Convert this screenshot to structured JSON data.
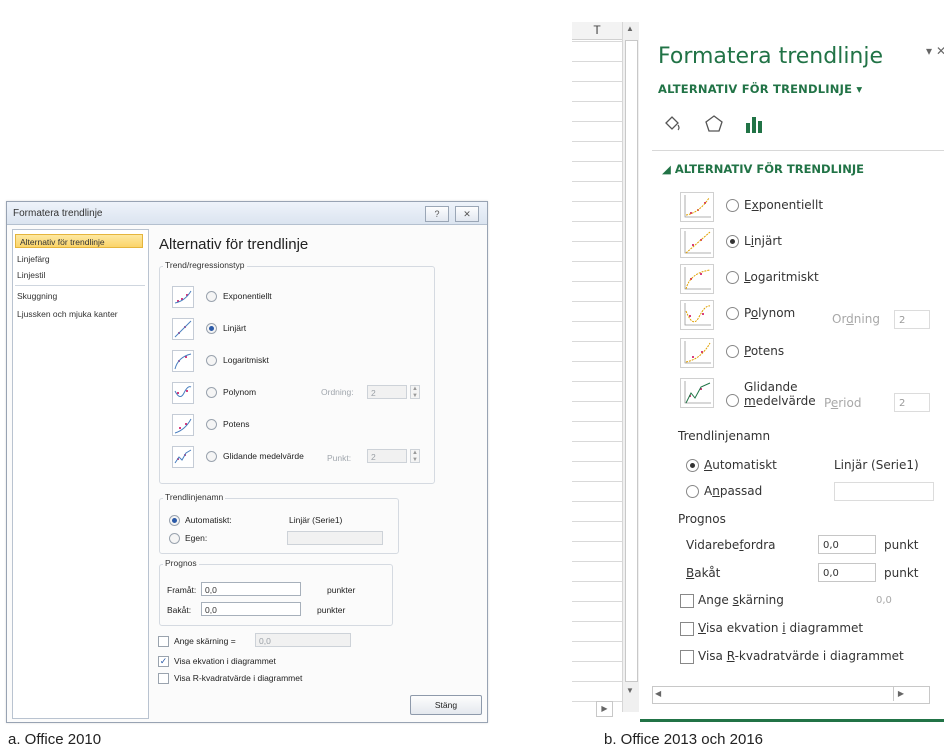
{
  "office2010": {
    "title": "Formatera trendlinje",
    "help_btn": "?",
    "close_btn": "✕",
    "sidebar": [
      "Alternativ för trendlinje",
      "Linjefärg",
      "Linjestil",
      "Skuggning",
      "Ljussken och mjuka kanter"
    ],
    "heading": "Alternativ för trendlinje",
    "group_type": "Trend/regressionstyp",
    "options": [
      "Exponentiellt",
      "Linjärt",
      "Logaritmiskt",
      "Polynom",
      "Potens",
      "Glidande medelvärde"
    ],
    "order_label": "Ordning:",
    "order_value": "2",
    "period_label": "Punkt:",
    "period_value": "2",
    "group_name": "Trendlinjenamn",
    "auto_label": "Automatiskt:",
    "auto_value": "Linjär (Serie1)",
    "custom_label": "Egen:",
    "group_forecast": "Prognos",
    "forward_label": "Framåt:",
    "forward_value": "0,0",
    "backward_label": "Bakåt:",
    "backward_value": "0,0",
    "unit": "punkter",
    "intercept_label": "Ange skärning =",
    "intercept_value": "0,0",
    "show_eq": "Visa ekvation i diagrammet",
    "show_r2": "Visa R-kvadratvärde i diagrammet",
    "close": "Stäng",
    "caption": "a.     Office 2010"
  },
  "office2013": {
    "col_header": "T",
    "title": "Formatera trendlinje",
    "pane_menu": "▾",
    "pane_close": "✕",
    "subheader": "ALTERNATIV FÖR TRENDLINJE ▾",
    "section": "◢ ALTERNATIV FÖR TRENDLINJE",
    "order_label": "Ordning",
    "order_value": "2",
    "period_label": "Period",
    "period_value": "2",
    "name_label": "Trendlinjenamn",
    "auto_value": "Linjär (Serie1)",
    "forecast_label": "Prognos",
    "forward_value": "0,0",
    "backward_value": "0,0",
    "unit": "punkt",
    "intercept_value": "0,0",
    "caption": "b. Office 2013 och 2016"
  },
  "colors": {
    "excel_green": "#217346",
    "selection_orange": "#fbd46a"
  }
}
